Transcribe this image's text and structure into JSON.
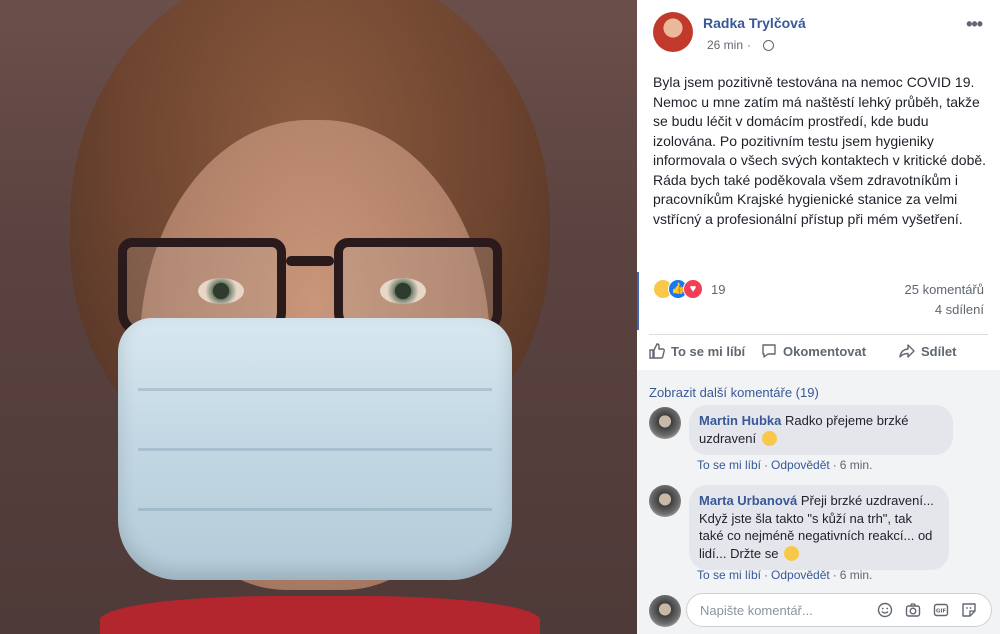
{
  "post": {
    "author": "Radka Trylčová",
    "time": "26 min",
    "text": "Byla jsem pozitivně testována na nemoc COVID 19. Nemoc u mne zatím má naštěstí lehký průběh, takže se budu léčit v domácím prostředí, kde budu izolována. Po pozitivním testu jsem hygieniky informovala o všech svých kontaktech v kritické době. Ráda bych také poděkovala všem zdravotníkům i pracovníkům Krajské hygienické stanice za velmi vstřícný a profesionální přístup při mém vyšetření.",
    "audience_icon": "globe-icon",
    "more_icon": "more-icon"
  },
  "stats": {
    "reaction_icons": [
      "sad-icon",
      "like-icon",
      "love-icon"
    ],
    "reactions": "19",
    "comments": "25 komentářů",
    "shares": "4 sdílení"
  },
  "actions": {
    "like": "To se mi líbí",
    "comment": "Okomentovat",
    "share": "Sdílet"
  },
  "comments": {
    "more_link": "Zobrazit další komentáře (19)",
    "items": [
      {
        "name": "Martin Hubka",
        "text": "Radko přejeme brzké uzdravení",
        "emoji": "flexed-biceps-emoji",
        "like": "To se mi líbí",
        "reply": "Odpovědět",
        "time": "6 min."
      },
      {
        "name": "Marta Urbanová",
        "text": "Přeji brzké uzdravení... Když jste šla takto \"s kůží na trh\", tak také co nejméně negativních reakcí... od lidí... Držte se",
        "emoji": "smiley-emoji",
        "like": "To se mi líbí",
        "reply": "Odpovědět",
        "time": "6 min."
      }
    ]
  },
  "composer": {
    "placeholder": "Napište komentář...",
    "tools": [
      "emoji-icon",
      "camera-icon",
      "gif-icon",
      "sticker-icon"
    ]
  },
  "colors": {
    "link": "#385898",
    "accent": "#4267b2",
    "text": "#1d2129",
    "muted": "#606770"
  }
}
